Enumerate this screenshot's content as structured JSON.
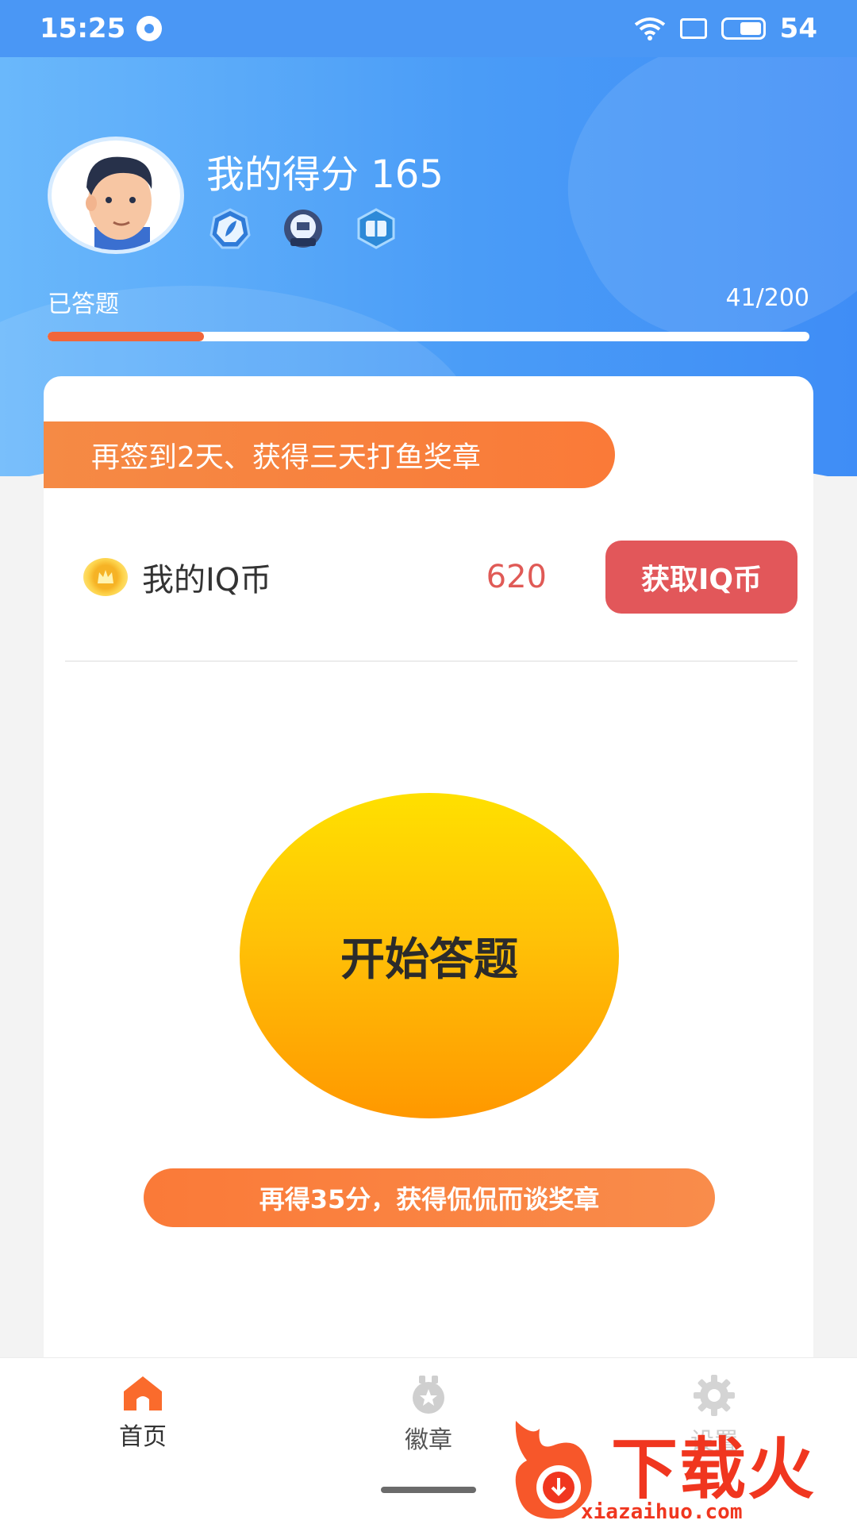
{
  "status_bar": {
    "time": "15:25",
    "battery": "54"
  },
  "profile": {
    "score_label": "我的得分 165",
    "progress_label": "已答题",
    "progress_count": "41/200",
    "progress_fraction": 0.205,
    "badges": [
      "leaf-badge-icon",
      "2020-badge-icon",
      "book-badge-icon"
    ]
  },
  "card": {
    "checkin_text": "再签到2天、获得三天打鱼奖章",
    "iq_label": "我的IQ币",
    "iq_value": "620",
    "get_iq_label": "获取IQ币",
    "start_label": "开始答题",
    "score_banner": "再得35分，获得侃侃而谈奖章"
  },
  "nav": {
    "home": "首页",
    "badges": "徽章",
    "settings": "设置"
  },
  "watermark": {
    "text": "下载火",
    "url": "xiazaihuo.com"
  },
  "colors": {
    "header_blue": "#4a9cf7",
    "accent_orange": "#fa7a38",
    "iq_red": "#e2575a",
    "start_yellow": "#ffc107"
  }
}
